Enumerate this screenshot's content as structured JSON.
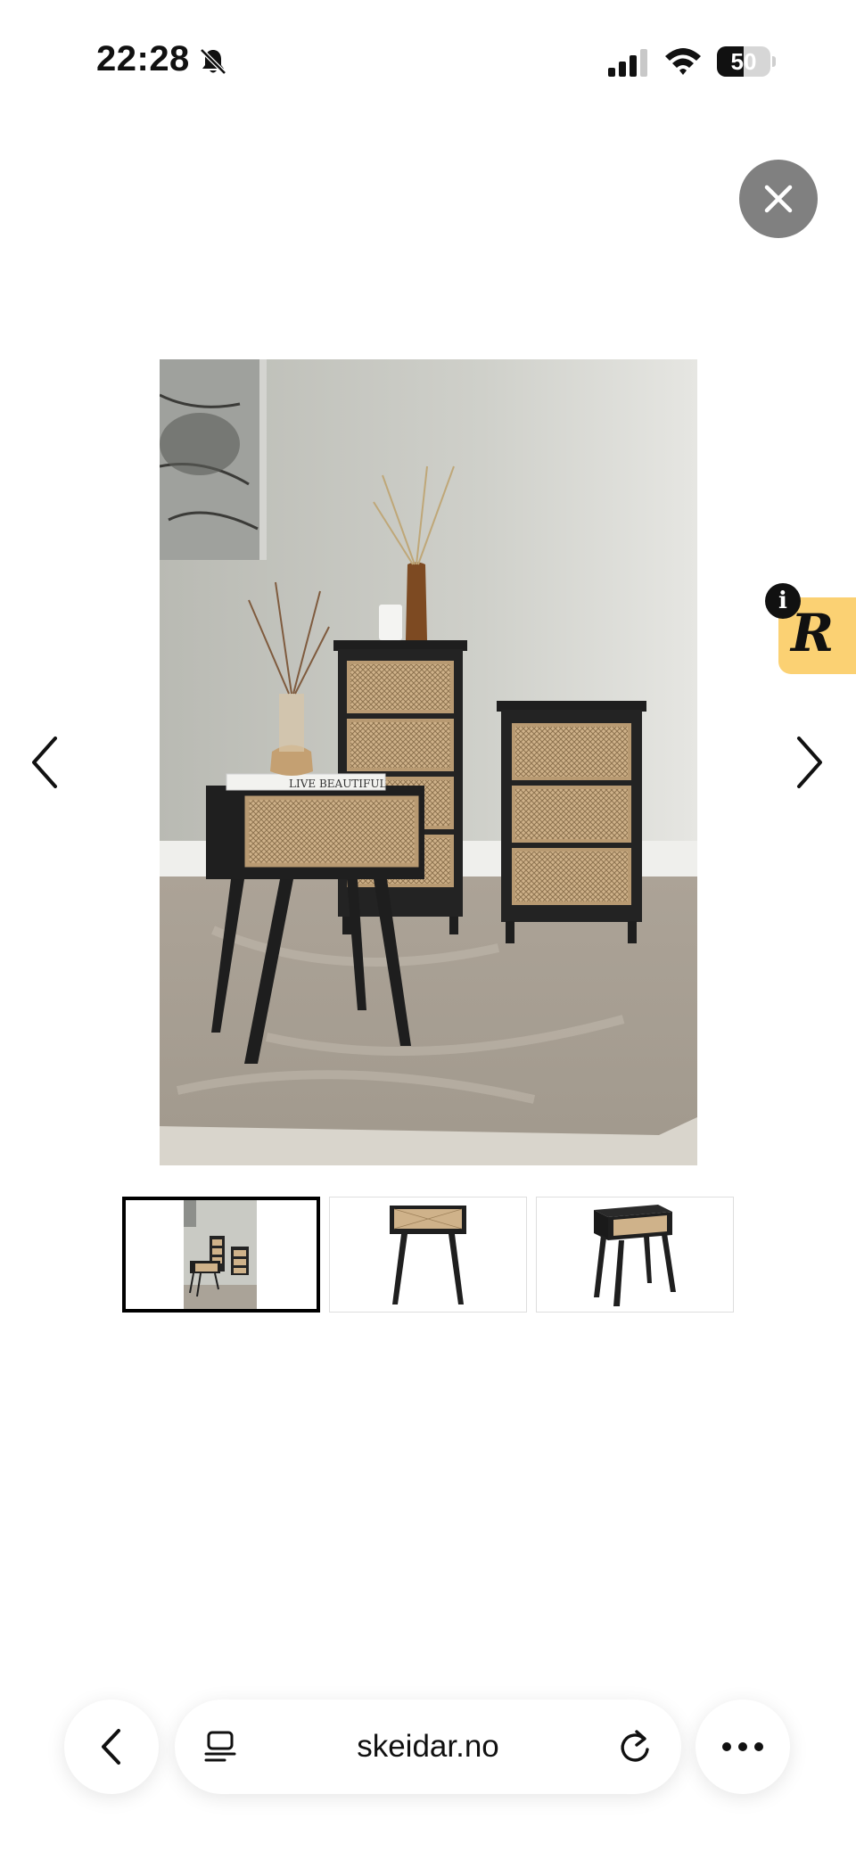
{
  "status_bar": {
    "time": "22:28",
    "battery_level": "50",
    "battery_fraction": 0.5,
    "icons": [
      "bell-slash-icon",
      "cellular-signal-icon",
      "wifi-icon",
      "battery-icon"
    ]
  },
  "viewer": {
    "close_icon": "close-icon",
    "prev_icon": "chevron-left-icon",
    "next_icon": "chevron-right-icon",
    "main_image_text": "LIVE BEAUTIFUL",
    "thumbnails": [
      {
        "icon": "room-photo",
        "selected": true
      },
      {
        "icon": "nightstand-front",
        "selected": false
      },
      {
        "icon": "nightstand-angle",
        "selected": false
      }
    ]
  },
  "widget": {
    "letter": "R",
    "info_label": "i",
    "color": "#fbd173"
  },
  "browser_bar": {
    "url": "skeidar.no",
    "back_icon": "chevron-left-icon",
    "reader_icon": "reader-icon",
    "reload_icon": "reload-icon",
    "more_icon": "more-icon"
  }
}
